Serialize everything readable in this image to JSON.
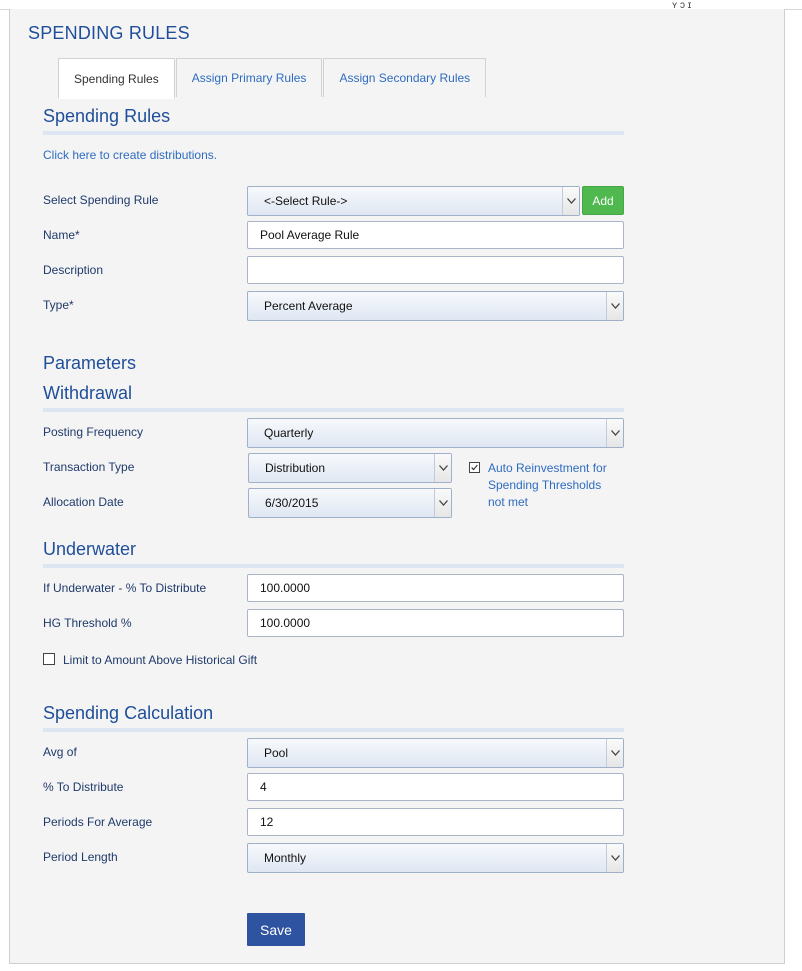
{
  "page": {
    "title": "SPENDING RULES",
    "top_fragment": "ʏ ɔ  ɪ"
  },
  "tabs": [
    {
      "label": "Spending Rules",
      "active": true
    },
    {
      "label": "Assign Primary Rules",
      "active": false
    },
    {
      "label": "Assign Secondary Rules",
      "active": false
    }
  ],
  "rules_section": {
    "heading": "Spending Rules",
    "create_link": "Click here to create distributions.",
    "select_label": "Select Spending Rule",
    "select_value": "<-Select Rule->",
    "add_label": "Add",
    "name_label": "Name*",
    "name_value": "Pool Average Rule",
    "description_label": "Description",
    "description_value": "",
    "type_label": "Type*",
    "type_value": "Percent Average"
  },
  "parameters": {
    "heading": "Parameters"
  },
  "withdrawal": {
    "heading": "Withdrawal",
    "posting_frequency_label": "Posting Frequency",
    "posting_frequency_value": "Quarterly",
    "transaction_type_label": "Transaction Type",
    "transaction_type_value": "Distribution",
    "allocation_date_label": "Allocation Date",
    "allocation_date_value": "6/30/2015",
    "auto_reinvest_label": "Auto Reinvestment for Spending Thresholds not met",
    "auto_reinvest_checked": true
  },
  "underwater": {
    "heading": "Underwater",
    "pct_label": "If Underwater - % To Distribute",
    "pct_value": "100.0000",
    "hg_label": "HG Threshold %",
    "hg_value": "100.0000",
    "limit_label": "Limit to Amount Above Historical Gift",
    "limit_checked": false
  },
  "calculation": {
    "heading": "Spending Calculation",
    "avg_label": "Avg of",
    "avg_value": "Pool",
    "distribute_label": "% To Distribute",
    "distribute_value": "4",
    "periods_label": "Periods For Average",
    "periods_value": "12",
    "length_label": "Period Length",
    "length_value": "Monthly"
  },
  "save_label": "Save",
  "colors": {
    "heading": "#1f4e9a",
    "link": "#2f6cc0",
    "add_button": "#4fb84f",
    "save_button": "#2e53a0",
    "rule": "#dce6f1"
  }
}
